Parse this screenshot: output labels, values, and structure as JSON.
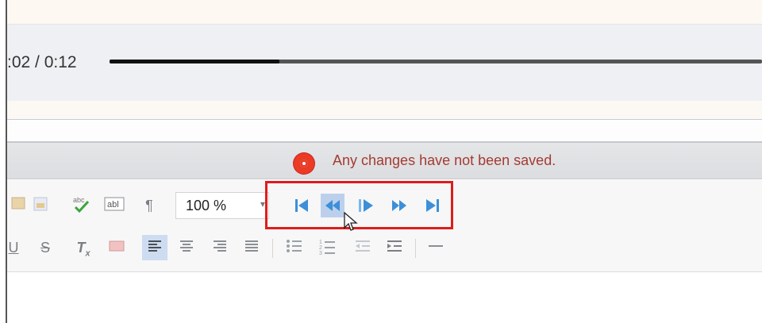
{
  "player": {
    "time_display": ":02 / 0:12",
    "progress": 0.26
  },
  "notification": {
    "icon": "stop-sign-icon",
    "message": "Any changes have not been saved.",
    "color": "#a33b32"
  },
  "toolbar": {
    "zoom_value": "100 %",
    "spellcheck_label": "abc",
    "form_field_label": "abl",
    "pilcrow": "¶",
    "navigation": [
      {
        "name": "first-page-button",
        "icon": "skip-to-start-icon"
      },
      {
        "name": "previous-page-button",
        "icon": "rewind-icon",
        "active": true
      },
      {
        "name": "next-page-button",
        "icon": "play-step-icon"
      },
      {
        "name": "fast-forward-button",
        "icon": "fast-forward-icon"
      },
      {
        "name": "last-page-button",
        "icon": "skip-to-end-icon"
      }
    ],
    "highlight_color": "#e11c1c",
    "accent_color": "#3c8fd8"
  }
}
